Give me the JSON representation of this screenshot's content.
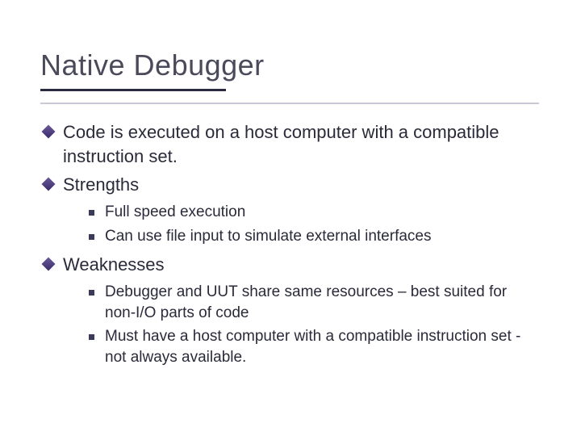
{
  "title": "Native Debugger",
  "bullets": [
    {
      "text": "Code is executed on a host computer with a compatible instruction set."
    },
    {
      "text": "Strengths",
      "sub": [
        {
          "text": "Full speed execution"
        },
        {
          "text": "Can use file input to simulate external interfaces"
        }
      ]
    },
    {
      "text": "Weaknesses",
      "sub": [
        {
          "text": "Debugger and UUT share same resources – best suited for non-I/O parts of code"
        },
        {
          "text": "Must have a host computer with a compatible instruction set - not always available."
        }
      ]
    }
  ]
}
